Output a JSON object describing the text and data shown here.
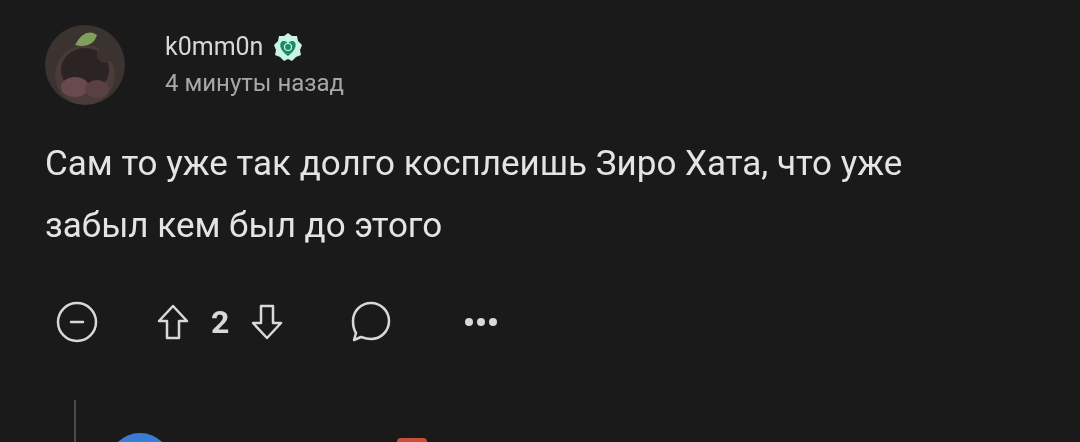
{
  "comment": {
    "author": "k0mm0n",
    "time": "4 минуты назад",
    "body": "Сам то уже так долго косплеишь Зиро Хата, что уже забыл кем был до этого",
    "score": "2"
  }
}
